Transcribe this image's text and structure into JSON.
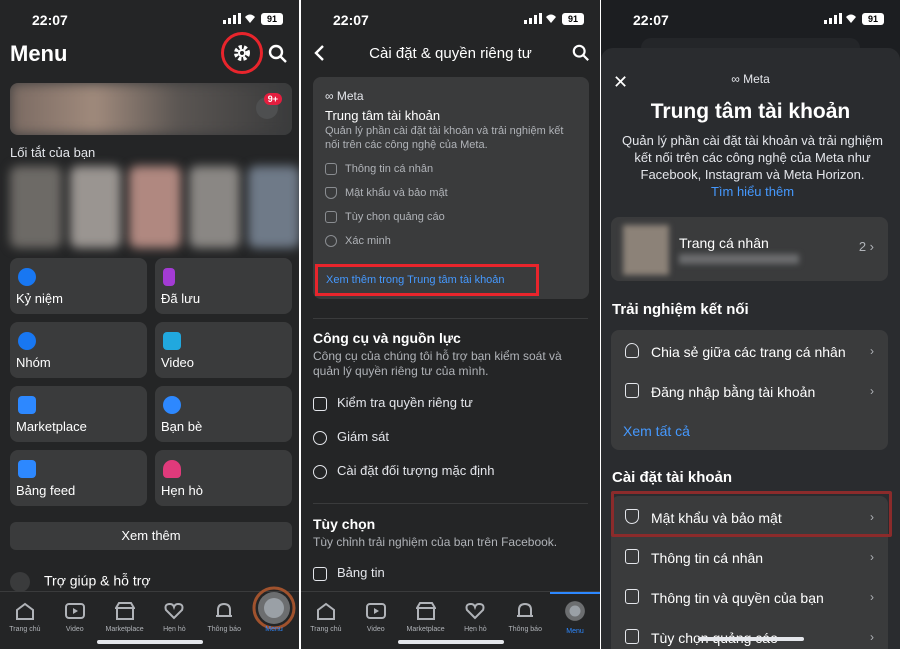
{
  "status": {
    "time": "22:07",
    "battery": "91"
  },
  "panel1": {
    "title": "Menu",
    "notif_badge": "9+",
    "shortcuts_title": "Lối tắt của bạn",
    "tiles": [
      {
        "label": "Kỷ niệm",
        "icon": "clock-icon",
        "color": "#1877f2"
      },
      {
        "label": "Đã lưu",
        "icon": "bookmark-icon",
        "color": "#a33bd4"
      },
      {
        "label": "Nhóm",
        "icon": "groups-icon",
        "color": "#1877f2"
      },
      {
        "label": "Video",
        "icon": "video-icon",
        "color": "#21a8de"
      },
      {
        "label": "Marketplace",
        "icon": "store-icon",
        "color": "#2d88ff"
      },
      {
        "label": "Bạn bè",
        "icon": "friends-icon",
        "color": "#2d88ff"
      },
      {
        "label": "Bảng feed",
        "icon": "feed-icon",
        "color": "#2d88ff"
      },
      {
        "label": "Hẹn hò",
        "icon": "heart-icon",
        "color": "#e03a7b"
      }
    ],
    "see_more": "Xem thêm",
    "help": "Trợ giúp & hỗ trợ"
  },
  "tabs": [
    {
      "label": "Trang chủ",
      "icon": "home-icon"
    },
    {
      "label": "Video",
      "icon": "video-icon"
    },
    {
      "label": "Marketplace",
      "icon": "store-icon"
    },
    {
      "label": "Hẹn hò",
      "icon": "heart-icon"
    },
    {
      "label": "Thông báo",
      "icon": "bell-icon"
    },
    {
      "label": "Menu",
      "icon": "avatar-icon"
    }
  ],
  "panel2": {
    "title": "Cài đặt & quyền riêng tư",
    "account_card": {
      "meta": "∞ Meta",
      "title": "Trung tâm tài khoản",
      "desc": "Quản lý phần cài đặt tài khoản và trải nghiệm kết nối trên các công nghệ của Meta.",
      "rows": [
        "Thông tin cá nhân",
        "Mật khẩu và bảo mật",
        "Tùy chọn quảng cáo",
        "Xác minh"
      ],
      "link": "Xem thêm trong Trung tâm tài khoản"
    },
    "tools_title": "Công cụ và nguồn lực",
    "tools_desc": "Công cụ của chúng tôi hỗ trợ bạn kiểm soát và quản lý quyền riêng tư của mình.",
    "tools_items": [
      "Kiểm tra quyền riêng tư",
      "Giám sát",
      "Cài đặt đối tượng mặc định"
    ],
    "options_title": "Tùy chọn",
    "options_desc": "Tùy chỉnh trải nghiệm của bạn trên Facebook.",
    "options_items": [
      "Bảng tin"
    ]
  },
  "panel3": {
    "meta": "∞ Meta",
    "title": "Trung tâm tài khoản",
    "desc": "Quản lý phần cài đặt tài khoản và trải nghiệm kết nối trên các công nghệ của Meta như Facebook, Instagram và Meta Horizon.",
    "learn_more": "Tìm hiểu thêm",
    "profile": {
      "name": "Trang cá nhân",
      "count": "2"
    },
    "connected_title": "Trải nghiệm kết nối",
    "connected_items": [
      "Chia sẻ giữa các trang cá nhân",
      "Đăng nhập bằng tài khoản"
    ],
    "see_all": "Xem tất cả",
    "settings_title": "Cài đặt tài khoản",
    "settings_items": [
      "Mật khẩu và bảo mật",
      "Thông tin cá nhân",
      "Thông tin và quyền của bạn",
      "Tùy chọn quảng cáo"
    ]
  }
}
